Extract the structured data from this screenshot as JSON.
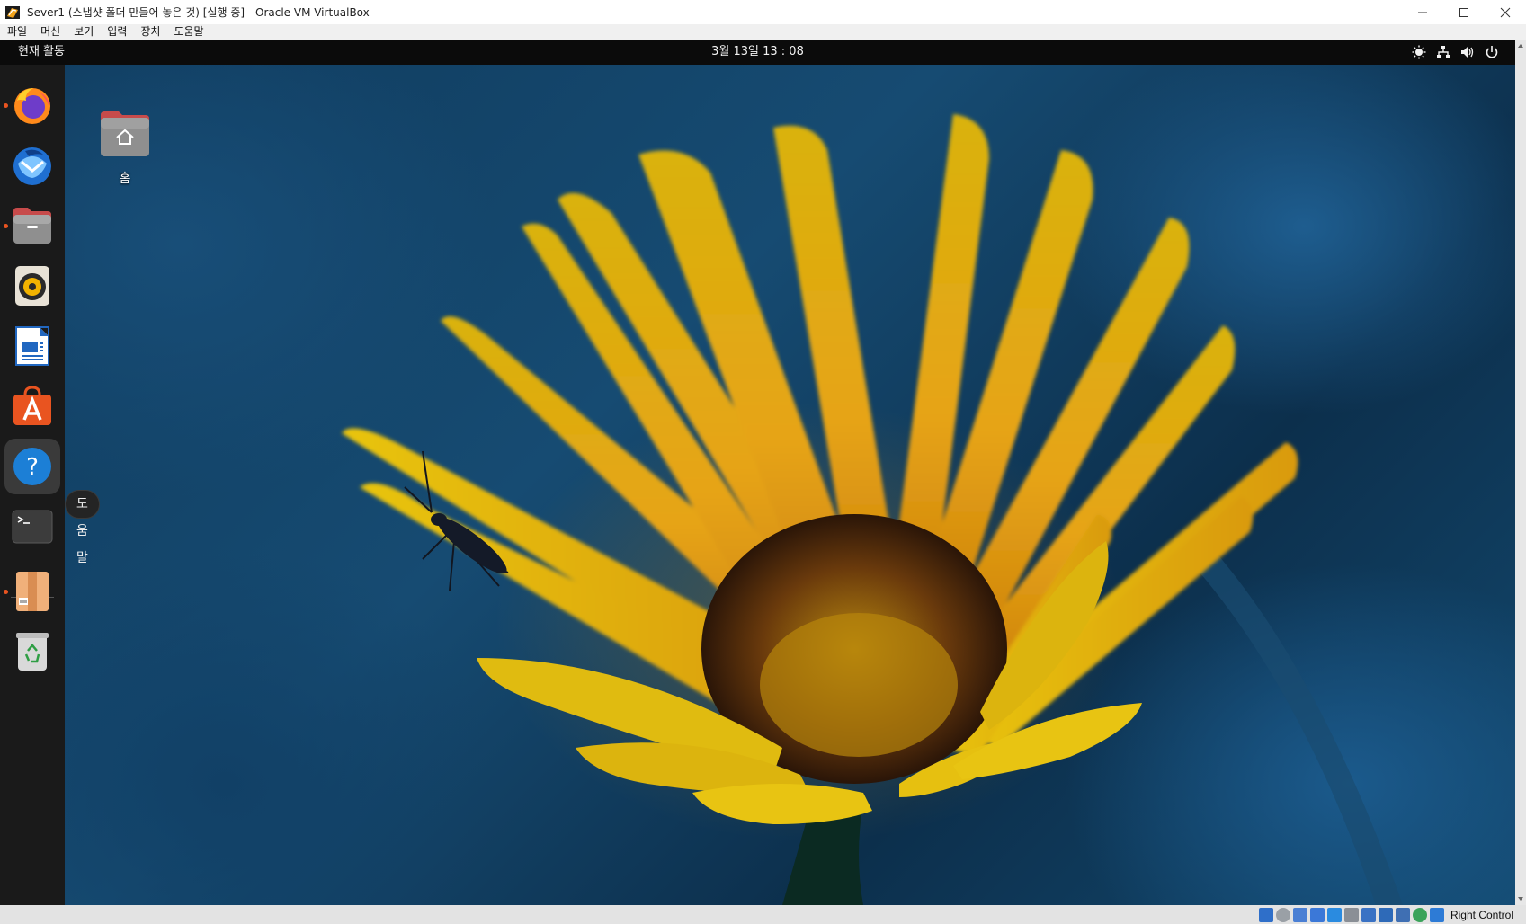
{
  "window": {
    "title": "Sever1 (스냅샷 폴더 만들어 놓은 것) [실행 중] - Oracle VM VirtualBox",
    "controls": [
      "minimize",
      "maximize",
      "close"
    ]
  },
  "menubar": {
    "items": [
      {
        "label": "파일"
      },
      {
        "label": "머신"
      },
      {
        "label": "보기"
      },
      {
        "label": "입력"
      },
      {
        "label": "장치"
      },
      {
        "label": "도움말"
      }
    ]
  },
  "topbar": {
    "activities": "현재 활동",
    "clock": "3월 13일  13 : 08",
    "tray_icons": [
      "accessibility-icon",
      "network-icon",
      "volume-icon",
      "power-icon"
    ]
  },
  "dock": {
    "items": [
      {
        "name": "firefox",
        "running": true
      },
      {
        "name": "thunderbird",
        "running": false
      },
      {
        "name": "files",
        "running": true
      },
      {
        "name": "rhythmbox",
        "running": false
      },
      {
        "name": "libreoffice-writer",
        "running": false
      },
      {
        "name": "app-center",
        "running": false
      },
      {
        "name": "help",
        "running": false,
        "active": true
      },
      {
        "name": "terminal",
        "running": false
      },
      {
        "name": "archive-manager",
        "running": true
      },
      {
        "name": "trash",
        "running": false
      }
    ],
    "tooltip": "도움말",
    "accent": "#e95420"
  },
  "desktop": {
    "icons": [
      {
        "label": "홈"
      }
    ]
  },
  "statusbar": {
    "host_key": "Right Control"
  }
}
